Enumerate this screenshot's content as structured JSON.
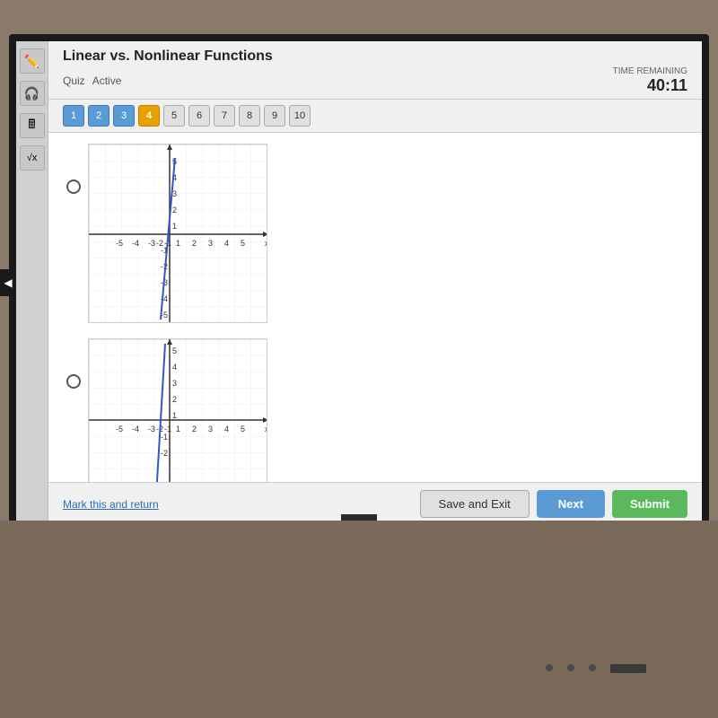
{
  "header": {
    "title": "Linear vs. Nonlinear Functions",
    "quiz_label": "Quiz",
    "active_label": "Active",
    "time_remaining_label": "TIME REMAINING",
    "time_value": "40:11"
  },
  "question_numbers": [
    1,
    2,
    3,
    4,
    5,
    6,
    7,
    8,
    9,
    10
  ],
  "active_question": 4,
  "answered_questions": [
    1,
    2,
    3
  ],
  "footer": {
    "mark_return_label": "Mark this and return",
    "save_exit_label": "Save and Exit",
    "next_label": "Next",
    "submit_label": "Submit"
  },
  "toolbar": {
    "icons": [
      "✏️",
      "🎧",
      "🖩",
      "√x"
    ]
  }
}
